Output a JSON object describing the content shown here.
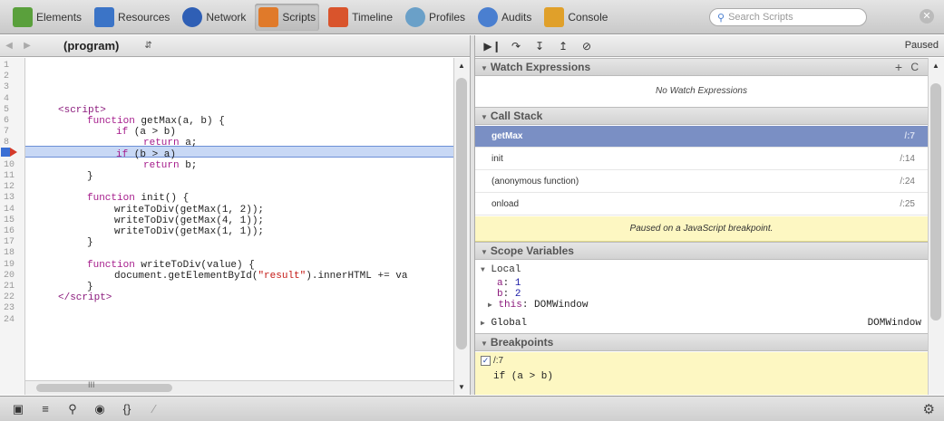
{
  "toolbar": {
    "items": [
      {
        "label": "Elements",
        "icon": "elements-icon",
        "color": "#5aa03c"
      },
      {
        "label": "Resources",
        "icon": "resources-icon",
        "color": "#3b74c7"
      },
      {
        "label": "Network",
        "icon": "network-icon",
        "color": "#2f5fb5"
      },
      {
        "label": "Scripts",
        "icon": "scripts-icon",
        "color": "#e07a2a"
      },
      {
        "label": "Timeline",
        "icon": "timeline-icon",
        "color": "#d9542c"
      },
      {
        "label": "Profiles",
        "icon": "profiles-icon",
        "color": "#6aa0c8"
      },
      {
        "label": "Audits",
        "icon": "audits-icon",
        "color": "#4a7fd0"
      },
      {
        "label": "Console",
        "icon": "console-icon",
        "color": "#e0a02a"
      }
    ],
    "active": "Scripts",
    "search_placeholder": "Search Scripts"
  },
  "source": {
    "select_label": "(program)",
    "line_numbers": [
      "1",
      "2",
      "3",
      "4",
      "5",
      "6",
      "7",
      "8",
      "9",
      "10",
      "11",
      "12",
      "13",
      "14",
      "15",
      "16",
      "17",
      "18",
      "19",
      "20",
      "21",
      "22",
      "23",
      "24"
    ],
    "h_scroll_label": "III"
  },
  "debugger": {
    "status": "Paused",
    "watch": {
      "title": "Watch Expressions",
      "empty": "No Watch Expressions",
      "add": "+",
      "refresh": "C"
    },
    "call_stack": {
      "title": "Call Stack",
      "frames": [
        {
          "name": "getMax",
          "loc": "/:7"
        },
        {
          "name": "init",
          "loc": "/:14"
        },
        {
          "name": "(anonymous function)",
          "loc": "/:24"
        },
        {
          "name": "onload",
          "loc": "/:25"
        }
      ],
      "pause_message": "Paused on a JavaScript breakpoint."
    },
    "scope": {
      "title": "Scope Variables",
      "local_label": "Local",
      "vars": [
        {
          "name": "a",
          "value": "1"
        },
        {
          "name": "b",
          "value": "2"
        }
      ],
      "this_label": "this",
      "this_value": "DOMWindow",
      "global_label": "Global",
      "global_value": "DOMWindow"
    },
    "breakpoints": {
      "title": "Breakpoints",
      "location": "/:7",
      "code": "if (a > b)"
    }
  },
  "colors": {
    "selection": "#7a8fc4",
    "pause_banner": "#fdf7c2",
    "highlight": "#c8d8f5"
  }
}
